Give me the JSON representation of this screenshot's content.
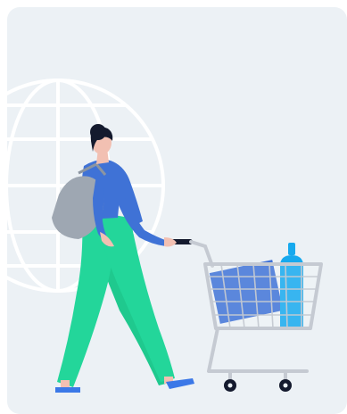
{
  "illustration": {
    "icons": [
      "globe-icon",
      "woman-shopper",
      "shopping-cart-icon",
      "shopping-bag",
      "blue-box",
      "water-bottle"
    ],
    "colors": {
      "card_background": "#ECF1F5",
      "globe_lines": "#FFFFFF",
      "hair": "#141A2E",
      "skin": "#F2C0B2",
      "shirt": "#3F72D6",
      "pants": "#23D69A",
      "bag": "#9EA7B2",
      "cart_frame": "#C5CAD2",
      "cart_wheels": "#141A2E",
      "box": "#3F72D6",
      "bottle": "#16A9EE",
      "shoes": "#3B78E7"
    }
  }
}
